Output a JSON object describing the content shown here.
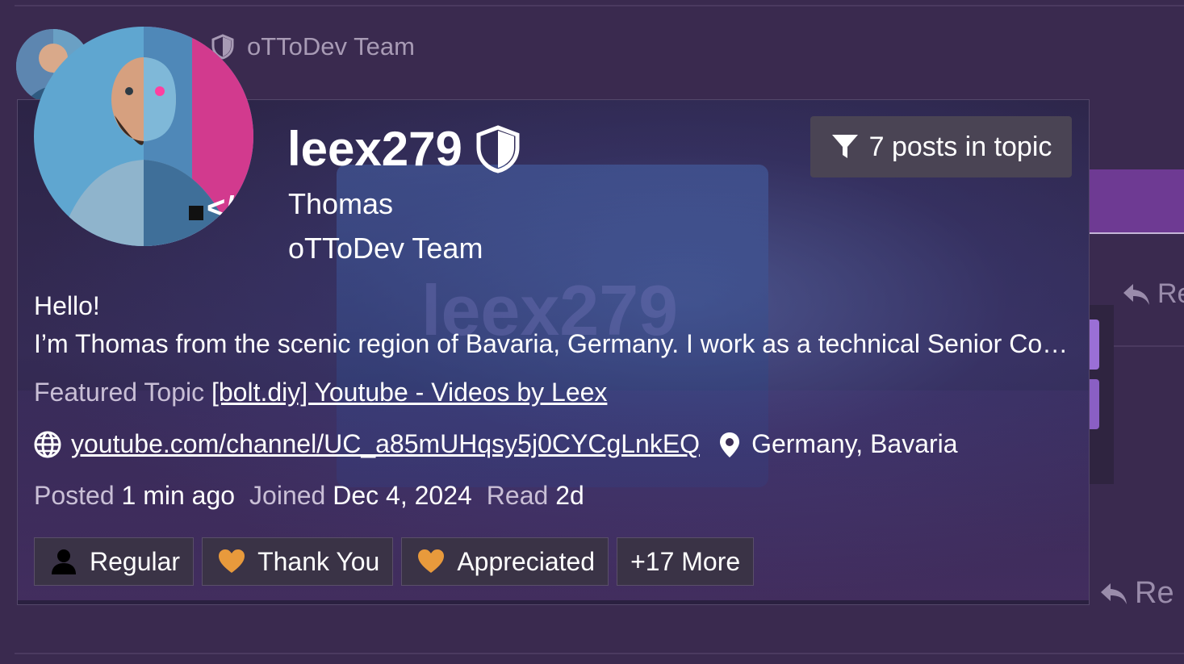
{
  "background_post": {
    "title": "oTToDev Team",
    "reply_label_1": "Re",
    "reply_label_2": "Re"
  },
  "card": {
    "username": "leex279",
    "full_name": "Thomas",
    "user_title": "oTToDev Team",
    "filter_button_label": "7 posts in topic",
    "bio_greeting": "Hello!",
    "bio_text": "I’m Thomas from the scenic region of Bavaria, Germany. I work as a technical Senior Consultant in ERP Systems.",
    "background_watermark": "leex279",
    "featured_topic_label": "Featured Topic",
    "featured_topic_link": "[bolt.diy] Youtube - Videos by Leex",
    "website_link": "youtube.com/channel/UC_a85mUHqsy5j0CYCgLnkEQ",
    "location": "Germany, Bavaria",
    "meta": {
      "posted_label": "Posted",
      "posted_value": "1 min ago",
      "joined_label": "Joined",
      "joined_value": "Dec 4, 2024",
      "read_label": "Read",
      "read_value": "2d"
    },
    "badges": [
      {
        "label": "Regular",
        "icon": "user-icon"
      },
      {
        "label": "Thank You",
        "icon": "heart-icon"
      },
      {
        "label": "Appreciated",
        "icon": "heart-icon"
      },
      {
        "label": "+17 More"
      }
    ]
  },
  "colors": {
    "background": "#3a2a4f",
    "heart": "#e89a3c",
    "accent_purple": "#6e3a93"
  }
}
